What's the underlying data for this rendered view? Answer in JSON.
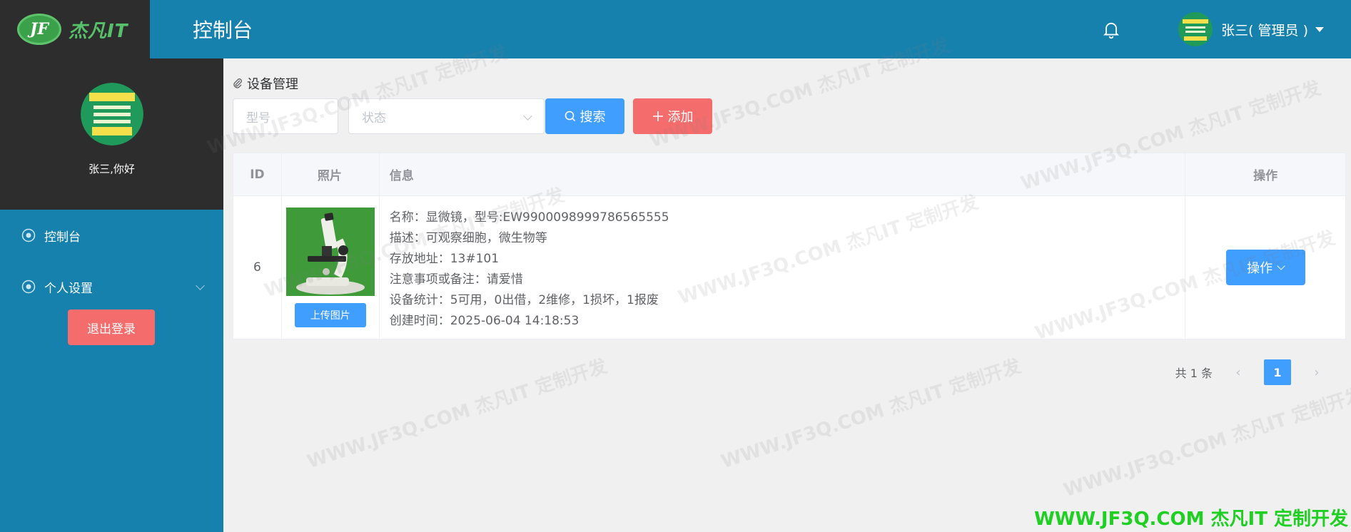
{
  "header": {
    "logo_mark": "JF",
    "logo_text": "杰凡IT",
    "title": "控制台",
    "user": "张三( 管理员 )"
  },
  "sidebar": {
    "greeting": "张三,你好",
    "items": [
      {
        "label": "控制台"
      },
      {
        "label": "个人设置"
      }
    ],
    "logout_label": "退出登录"
  },
  "main": {
    "breadcrumb": "设备管理",
    "filters": {
      "model_placeholder": "型号",
      "status_placeholder": "状态"
    },
    "search_label": "搜索",
    "add_label": "添加",
    "table": {
      "headers": {
        "id": "ID",
        "photo": "照片",
        "info": "信息",
        "op": "操作"
      },
      "rows": [
        {
          "id": "6",
          "upload_label": "上传图片",
          "lines": [
            "名称：显微镜，型号:EW9900098999786565555",
            "描述：可观察细胞，微生物等",
            "存放地址：13#101",
            "注意事项或备注：请爱惜",
            "设备统计：5可用，0出借，2维修，1损坏，1报废",
            "创建时间：2025-06-04 14:18:53"
          ],
          "op_label": "操作"
        }
      ]
    },
    "pagination": {
      "total": "共 1 条",
      "current": "1"
    }
  },
  "watermark": "WWW.JF3Q.COM 杰凡IT  定制开发",
  "colors": {
    "primary": "#409eff",
    "danger": "#f56c6c",
    "header": "#1781ad",
    "dark": "#2d2d2d"
  }
}
